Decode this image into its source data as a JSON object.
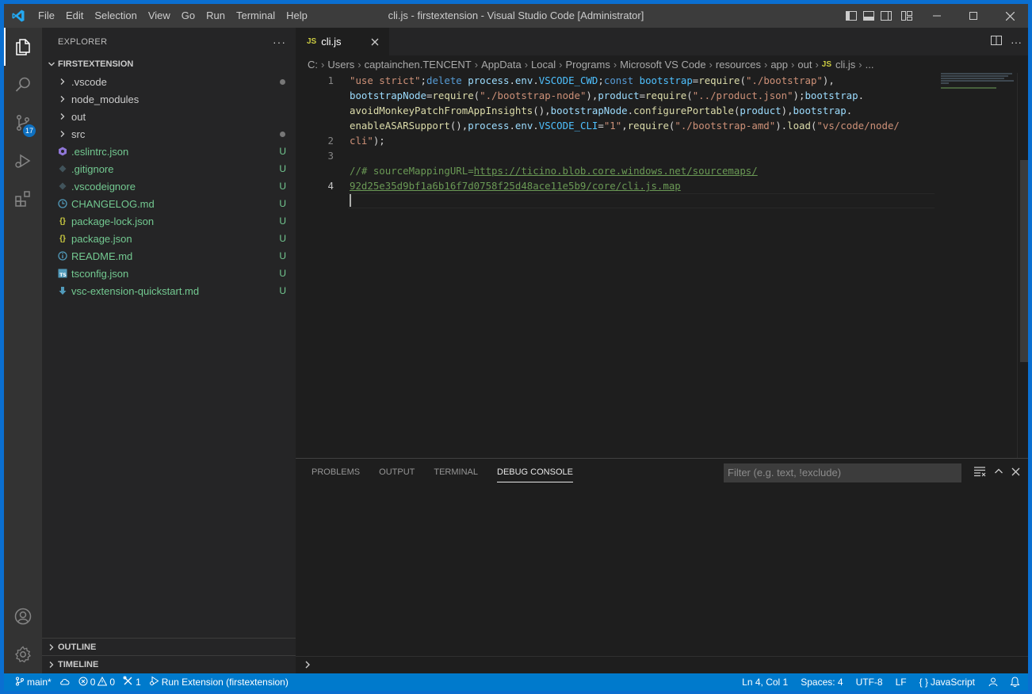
{
  "titlebar": {
    "menu": [
      "File",
      "Edit",
      "Selection",
      "View",
      "Go",
      "Run",
      "Terminal",
      "Help"
    ],
    "window_title": "cli.js - firstextension - Visual Studio Code [Administrator]"
  },
  "activitybar": {
    "source_control_badge": "17"
  },
  "sidebar": {
    "header": "EXPLORER",
    "root_folder": "FIRSTEXTENSION",
    "items": [
      {
        "label": ".vscode",
        "kind": "folder",
        "status": "dot"
      },
      {
        "label": "node_modules",
        "kind": "folder",
        "status": ""
      },
      {
        "label": "out",
        "kind": "folder",
        "status": ""
      },
      {
        "label": "src",
        "kind": "folder",
        "status": "dot"
      },
      {
        "label": ".eslintrc.json",
        "kind": "file",
        "status": "U"
      },
      {
        "label": ".gitignore",
        "kind": "file",
        "status": "U"
      },
      {
        "label": ".vscodeignore",
        "kind": "file",
        "status": "U"
      },
      {
        "label": "CHANGELOG.md",
        "kind": "file",
        "status": "U"
      },
      {
        "label": "package-lock.json",
        "kind": "file",
        "status": "U"
      },
      {
        "label": "package.json",
        "kind": "file",
        "status": "U"
      },
      {
        "label": "README.md",
        "kind": "file",
        "status": "U"
      },
      {
        "label": "tsconfig.json",
        "kind": "file",
        "status": "U"
      },
      {
        "label": "vsc-extension-quickstart.md",
        "kind": "file",
        "status": "U"
      }
    ],
    "outline": "OUTLINE",
    "timeline": "TIMELINE"
  },
  "editor": {
    "tab": {
      "icon_text": "JS",
      "label": "cli.js"
    },
    "breadcrumbs": [
      "C:",
      "Users",
      "captainchen.TENCENT",
      "AppData",
      "Local",
      "Programs",
      "Microsoft VS Code",
      "resources",
      "app",
      "out",
      "cli.js",
      "..."
    ],
    "breadcrumb_file_icon": "JS",
    "line_numbers": [
      "1",
      "2",
      "3",
      "4"
    ]
  },
  "panel": {
    "tabs": [
      "PROBLEMS",
      "OUTPUT",
      "TERMINAL",
      "DEBUG CONSOLE"
    ],
    "active_tab": "DEBUG CONSOLE",
    "filter_placeholder": "Filter (e.g. text, !exclude)"
  },
  "statusbar": {
    "branch": "main*",
    "errors": "0",
    "warnings": "0",
    "debug_sessions": "1",
    "run_config": "Run Extension (firstextension)",
    "cursor_position": "Ln 4, Col 1",
    "indentation": "Spaces: 4",
    "encoding": "UTF-8",
    "eol": "LF",
    "language": "JavaScript"
  },
  "colors": {
    "statusbar": "#007acc",
    "activity_bar": "#333333",
    "sidebar": "#252526",
    "editor": "#1e1e1e",
    "untracked": "#73c991"
  }
}
